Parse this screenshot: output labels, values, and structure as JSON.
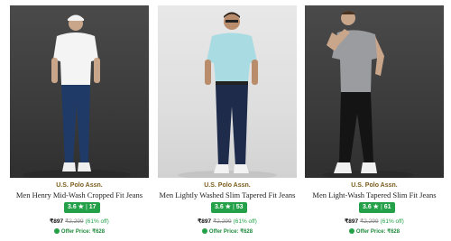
{
  "products": [
    {
      "brand": "U.S. Polo Assn.",
      "title": "Men Henry Mid-Wash Cropped Fit Jeans",
      "rating": "3.6 ★",
      "reviews": "17",
      "price": "₹897",
      "mrp": "₹2,299",
      "discount": "(61% off)",
      "offer": "Offer Price: ₹628"
    },
    {
      "brand": "U.S. Polo Assn.",
      "title": "Men Lightly Washed Slim Tapered Fit Jeans",
      "rating": "3.6 ★",
      "reviews": "53",
      "price": "₹897",
      "mrp": "₹2,299",
      "discount": "(61% off)",
      "offer": "Offer Price: ₹628"
    },
    {
      "brand": "U.S. Polo Assn.",
      "title": "Men Light-Wash Tapered Slim Fit Jeans",
      "rating": "3.6 ★",
      "reviews": "61",
      "price": "₹897",
      "mrp": "₹2,299",
      "discount": "(61% off)",
      "offer": "Offer Price: ₹628"
    }
  ],
  "colors": {
    "rating_badge": "#24a148",
    "brand_text": "#7a5c1b",
    "offer_text": "#1e8a3c"
  }
}
